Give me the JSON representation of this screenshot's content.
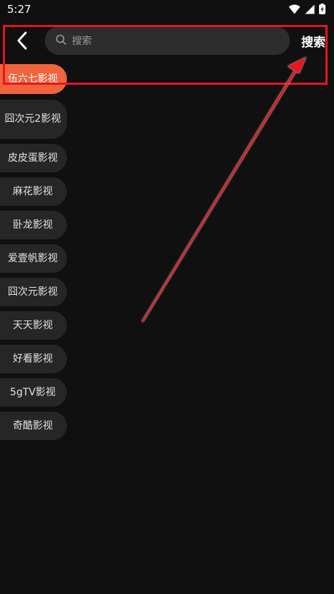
{
  "status": {
    "time": "5:27",
    "icons": [
      "wifi-icon",
      "signal-icon",
      "battery-charging-icon"
    ]
  },
  "header": {
    "back_icon": "chevron-left-icon",
    "search_icon": "search-icon",
    "search_placeholder": "搜索",
    "search_value": "",
    "search_button": "搜索"
  },
  "sidebar": {
    "selected_index": 0,
    "items": [
      {
        "label": "伍六七影视"
      },
      {
        "label": "囧次元2影视"
      },
      {
        "label": "皮皮蛋影视"
      },
      {
        "label": "麻花影视"
      },
      {
        "label": "卧龙影视"
      },
      {
        "label": "爱壹帆影视"
      },
      {
        "label": "囧次元影视"
      },
      {
        "label": "天天影视"
      },
      {
        "label": "好看影视"
      },
      {
        "label": "5gTV影视"
      },
      {
        "label": "奇酷影视"
      }
    ]
  },
  "colors": {
    "background": "#101010",
    "accent": "#f0643d",
    "annotation": "#e8141c"
  }
}
